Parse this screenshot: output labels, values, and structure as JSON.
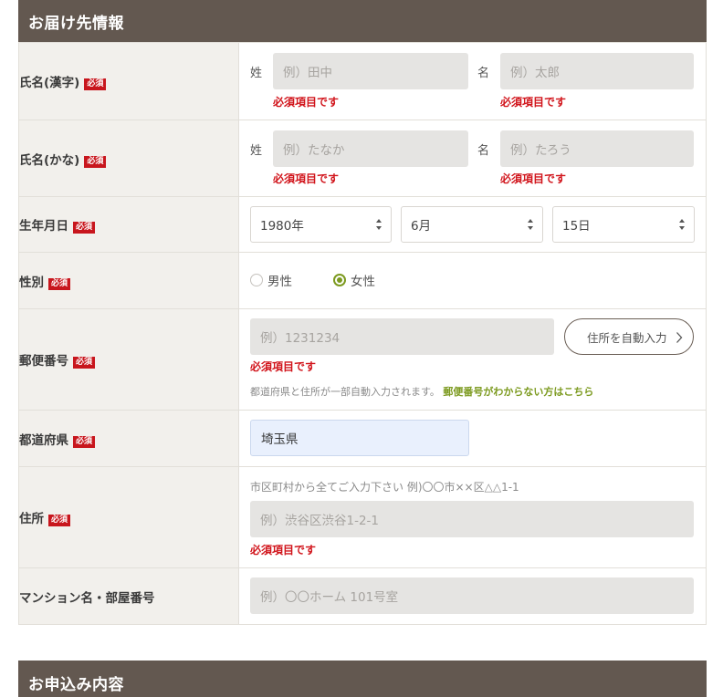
{
  "sections": {
    "delivery_title": "お届け先情報",
    "order_title": "お申込み内容"
  },
  "required_badge": "必須",
  "error_required": "必須項目です",
  "rows": {
    "name_kanji": {
      "label": "氏名(漢字)",
      "last_prefix": "姓",
      "last_placeholder": "例）田中",
      "first_prefix": "名",
      "first_placeholder": "例）太郎"
    },
    "name_kana": {
      "label": "氏名(かな)",
      "last_prefix": "姓",
      "last_placeholder": "例）たなか",
      "first_prefix": "名",
      "first_placeholder": "例）たろう"
    },
    "birthdate": {
      "label": "生年月日",
      "year": "1980年",
      "month": "6月",
      "day": "15日"
    },
    "gender": {
      "label": "性別",
      "options": [
        "男性",
        "女性"
      ],
      "selected": "女性"
    },
    "postal": {
      "label": "郵便番号",
      "placeholder": "例）1231234",
      "auto_fill_button": "住所を自動入力",
      "hint": "都道府県と住所が一部自動入力されます。",
      "hint_link": "郵便番号がわからない方はこちら"
    },
    "prefecture": {
      "label": "都道府県",
      "value": "埼玉県"
    },
    "address": {
      "label": "住所",
      "hint": "市区町村から全てご入力下さい 例)〇〇市××区△△1-1",
      "placeholder": "例）渋谷区渋谷1-2-1"
    },
    "building": {
      "label": "マンション名・部屋番号",
      "placeholder": "例）〇〇ホーム 101号室"
    }
  },
  "colors": {
    "header_bg": "#635850",
    "label_bg": "#f2f0ec",
    "required_red": "#c8161d",
    "accent_green": "#7c9a1f",
    "input_bg": "#e5e4e2",
    "autofill_bg": "#e9f0fd"
  }
}
